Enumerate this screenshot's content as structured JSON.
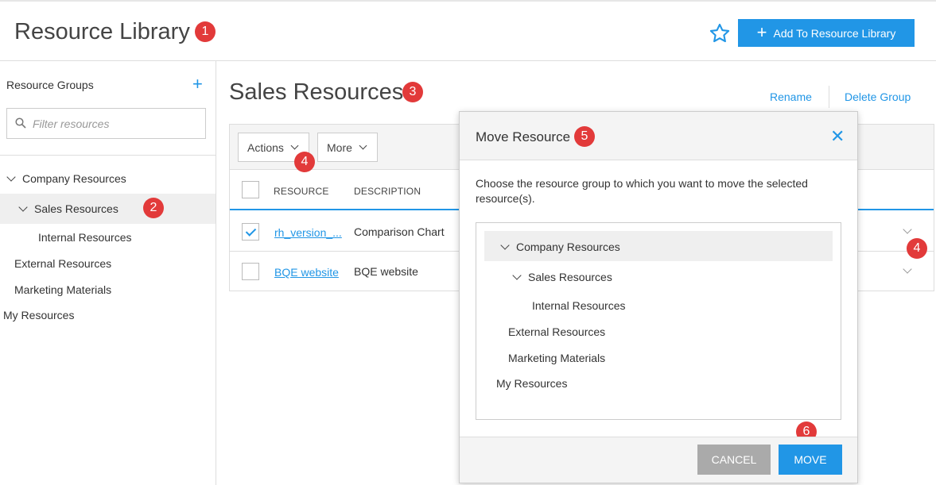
{
  "header": {
    "title": "Resource Library",
    "add_button": "Add To Resource Library"
  },
  "sidebar": {
    "heading": "Resource Groups",
    "filter_placeholder": "Filter resources",
    "items": [
      {
        "label": "Company Resources"
      },
      {
        "label": "Sales Resources"
      },
      {
        "label": "Internal Resources"
      },
      {
        "label": "External Resources"
      },
      {
        "label": "Marketing Materials"
      },
      {
        "label": "My Resources"
      }
    ]
  },
  "main": {
    "title": "Sales Resources",
    "rename_link": "Rename",
    "delete_link": "Delete Group",
    "actions_button": "Actions",
    "more_button": "More",
    "columns": {
      "resource": "RESOURCE",
      "description": "DESCRIPTION"
    },
    "rows": [
      {
        "resource": "rh_version_...",
        "description": "Comparison Chart",
        "checked": true
      },
      {
        "resource": "BQE website",
        "description": "BQE website",
        "checked": false
      }
    ]
  },
  "modal": {
    "title": "Move Resource",
    "description": "Choose the resource group to which you want to move the selected resource(s).",
    "tree": [
      {
        "label": "Company Resources"
      },
      {
        "label": "Sales Resources"
      },
      {
        "label": "Internal Resources"
      },
      {
        "label": "External Resources"
      },
      {
        "label": "Marketing Materials"
      },
      {
        "label": "My Resources"
      }
    ],
    "cancel_button": "CANCEL",
    "move_button": "MOVE"
  },
  "callouts": [
    "1",
    "2",
    "3",
    "4",
    "4",
    "5",
    "6"
  ],
  "colors": {
    "accent": "#2196e6",
    "callout": "#e23a3a",
    "cancel": "#aaaaaa"
  }
}
